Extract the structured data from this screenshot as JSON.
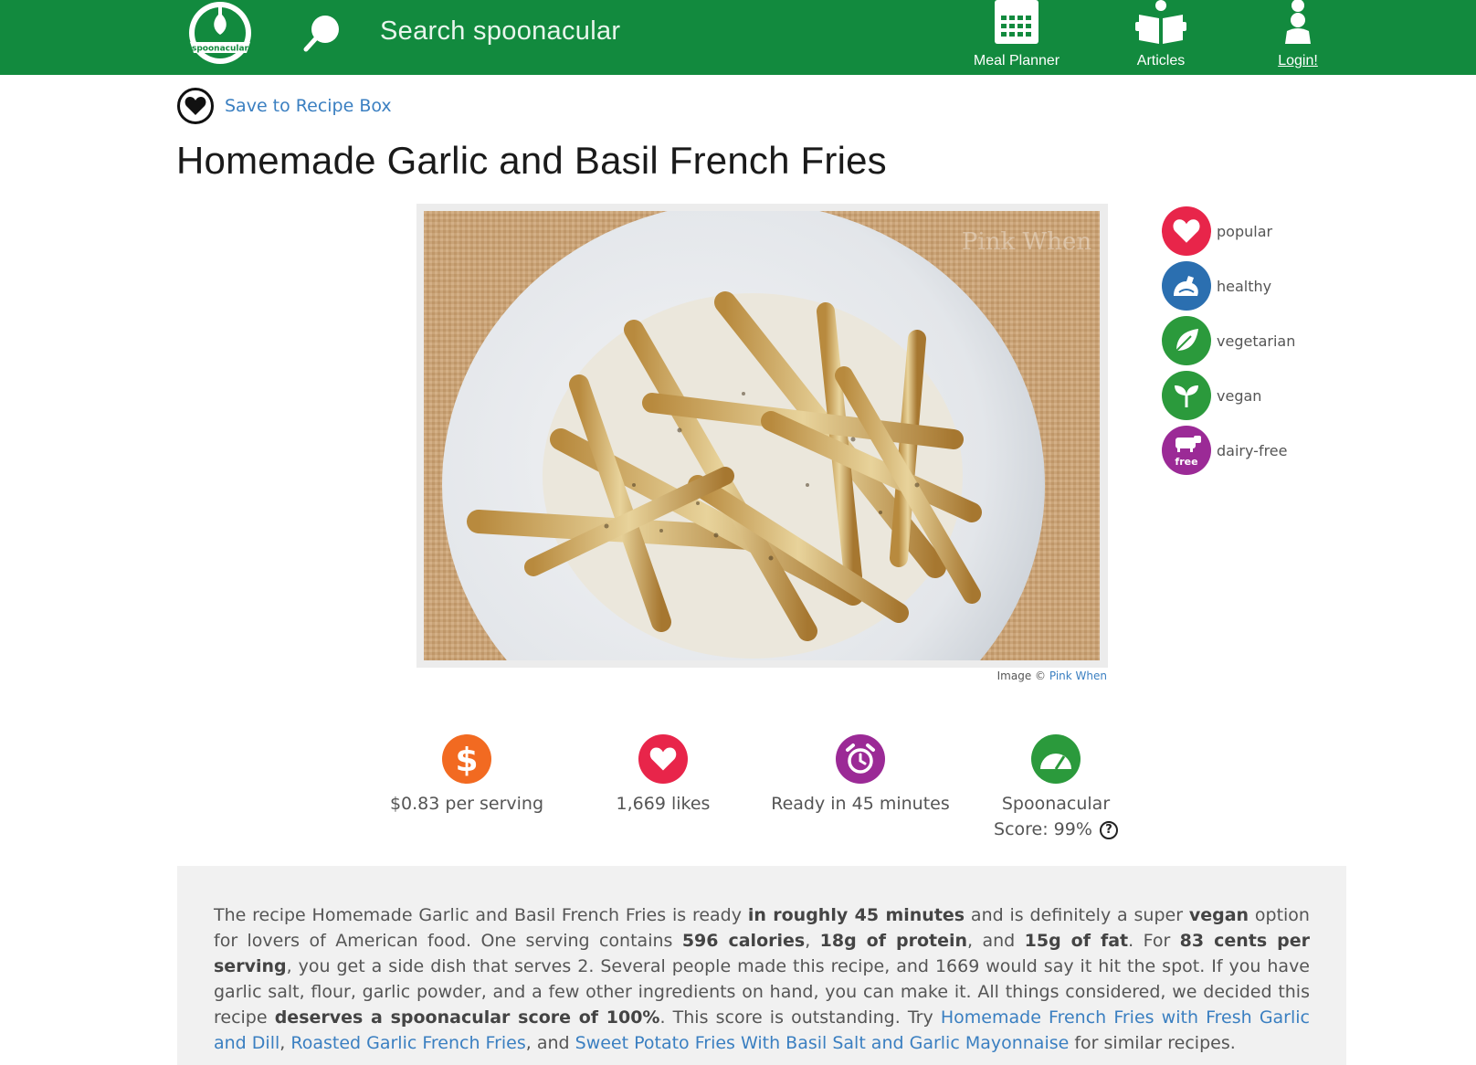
{
  "header": {
    "search_placeholder": "Search spoonacular",
    "nav": {
      "meal_planner": "Meal Planner",
      "articles": "Articles",
      "login": "Login!"
    },
    "logo_text": "spoonacular"
  },
  "save": {
    "label": "Save to Recipe Box"
  },
  "recipe": {
    "title": "Homemade Garlic and Basil French Fries",
    "image_credit_prefix": "Image © ",
    "image_credit_source": "Pink When",
    "watermark": "Pink When"
  },
  "badges": [
    {
      "label": "popular",
      "color": "#e8254a",
      "icon": "heart-icon"
    },
    {
      "label": "healthy",
      "color": "#2b6fb0",
      "icon": "muscle-icon"
    },
    {
      "label": "vegetarian",
      "color": "#2b9a3c",
      "icon": "leaf-icon"
    },
    {
      "label": "vegan",
      "color": "#2b9a3c",
      "icon": "sprout-icon"
    },
    {
      "label": "dairy-free",
      "color": "#9b2a96",
      "icon": "cow-icon",
      "sub": "free"
    }
  ],
  "stats": {
    "price": "$0.83 per serving",
    "likes": "1,669 likes",
    "ready": "Ready in 45 minutes",
    "score_line1": "Spoonacular",
    "score_line2": "Score: 99%",
    "help": "?"
  },
  "colors": {
    "brand_green": "#128a3e",
    "link_blue": "#3a7fc1",
    "price_orange": "#f26a21",
    "likes_red": "#e8254a",
    "time_purple": "#9b2a96",
    "score_green": "#2b9a3c"
  },
  "summary": {
    "p1": "The recipe Homemade Garlic and Basil French Fries is ready ",
    "b1": "in roughly 45 minutes",
    "p2": " and is definitely a super ",
    "b2": "vegan",
    "p3": " option for lovers of American food. One serving contains ",
    "b3": "596 calories",
    "p4": ", ",
    "b4": "18g of protein",
    "p5": ", and ",
    "b5": "15g of fat",
    "p6": ". For ",
    "b6": "83 cents per serving",
    "p7": ", you get a side dish that serves 2. Several people made this recipe, and 1669 would say it hit the spot. If you have garlic salt, flour, garlic powder, and a few other ingredients on hand, you can make it. All things considered, we decided this recipe ",
    "b7": "deserves a spoonacular score of 100%",
    "p8": ". This score is outstanding. Try ",
    "link1": "Homemade French Fries with Fresh Garlic and Dill",
    "p9": ", ",
    "link2": "Roasted Garlic French Fries",
    "p10": ", and ",
    "link3": "Sweet Potato Fries With Basil Salt and Garlic Mayonnaise",
    "p11": " for similar recipes."
  }
}
